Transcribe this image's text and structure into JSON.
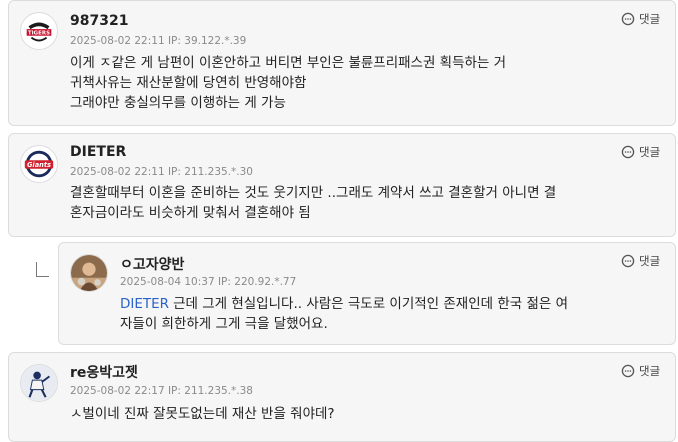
{
  "reply_label": "댓글",
  "comments": [
    {
      "nickname": "987321",
      "meta": "2025-08-02 22:11  IP: 39.122.*.39",
      "avatar": "tigers-logo",
      "avatar_text": "TIGERS",
      "lines": [
        "이게  ㅈ같은 게 남편이 이혼안하고 버티면 부인은 불륜프리패스권 획득하는 거",
        "귀책사유는 재산분할에 당연히 반영해야함",
        "그래야만 충실의무를 이행하는 게 가능"
      ]
    },
    {
      "nickname": "DIETER",
      "meta": "2025-08-02 22:11  IP: 211.235.*.30",
      "avatar": "giants-logo",
      "avatar_text": "Giants",
      "lines": [
        "결혼할때부터 이혼을 준비하는 것도 웃기지만 ..그래도 계약서 쓰고 결혼할거 아니면 결",
        "혼자금이라도 비슷하게 맞춰서 결혼해야 됨"
      ]
    },
    {
      "nickname": "ㅇ고자양반",
      "meta": "2025-08-04 10:37  IP: 220.92.*.77",
      "avatar": "user-photo",
      "mention": "DIETER",
      "lines": [
        "근데 그게 현실입니다.. 사람은 극도로 이기적인 존재인데 한국 젊은 여",
        "자들이 희한하게 그게 극을 달했어요."
      ]
    },
    {
      "nickname": "re옹박고젯",
      "meta": "2025-08-02 22:17  IP: 211.235.*.38",
      "avatar": "player-photo",
      "lines": [
        "ㅅ벌이네 진짜 잘못도없는데 재산 반을 줘야데?"
      ]
    }
  ]
}
